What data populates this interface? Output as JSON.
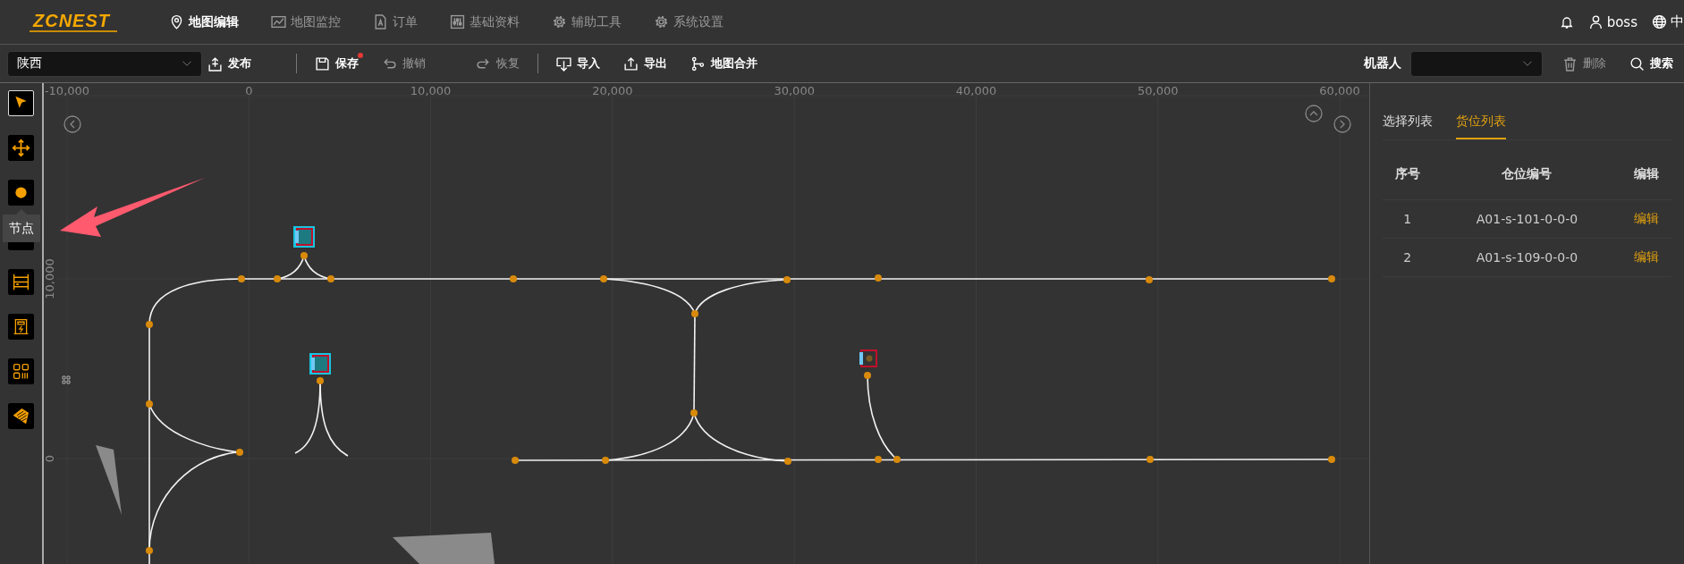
{
  "nav": {
    "logo": "ZCNEST",
    "items": [
      {
        "label": "地图编辑",
        "selected": true
      },
      {
        "label": "地图监控",
        "selected": false
      },
      {
        "label": "订单",
        "selected": false
      },
      {
        "label": "基础资料",
        "selected": false
      },
      {
        "label": "辅助工具",
        "selected": false
      },
      {
        "label": "系统设置",
        "selected": false
      }
    ],
    "user": "boss",
    "language": "中"
  },
  "toolbar": {
    "region": "陕西",
    "action_groups": [
      [
        {
          "label": "发布",
          "disabled": false
        }
      ],
      [
        {
          "label": "保存",
          "disabled": false,
          "unsaved": true
        },
        {
          "label": "撤销",
          "disabled": true
        },
        {
          "label": "恢复",
          "disabled": true
        }
      ],
      [
        {
          "label": "导入",
          "disabled": false
        },
        {
          "label": "导出",
          "disabled": false
        },
        {
          "label": "地图合并",
          "disabled": false
        }
      ]
    ],
    "robot_label": "机器人",
    "right_actions": [
      {
        "label": "删除",
        "disabled": true
      },
      {
        "label": "搜索",
        "disabled": false
      }
    ]
  },
  "tools": [
    {
      "selected": true
    },
    {
      "selected": false
    },
    {
      "selected": false,
      "tooltip": "节点"
    },
    {
      "selected": false
    },
    {
      "selected": false
    },
    {
      "selected": false
    },
    {
      "selected": false
    },
    {
      "selected": false
    }
  ],
  "canvas": {
    "x_ruler": [
      "-10,000",
      "0",
      "10,000",
      "20,000",
      "30,000",
      "40,000",
      "50,000",
      "60,000"
    ],
    "y_ruler": [
      "10,000",
      "0"
    ]
  },
  "panel": {
    "tabs": [
      {
        "label": "选择列表",
        "selected": false
      },
      {
        "label": "货位列表",
        "selected": true
      }
    ],
    "columns": [
      "序号",
      "仓位编号",
      "编辑"
    ],
    "rows": [
      [
        "1",
        "A01-s-101-0-0-0",
        "编辑"
      ],
      [
        "2",
        "A01-s-109-0-0-0",
        "编辑"
      ]
    ]
  }
}
